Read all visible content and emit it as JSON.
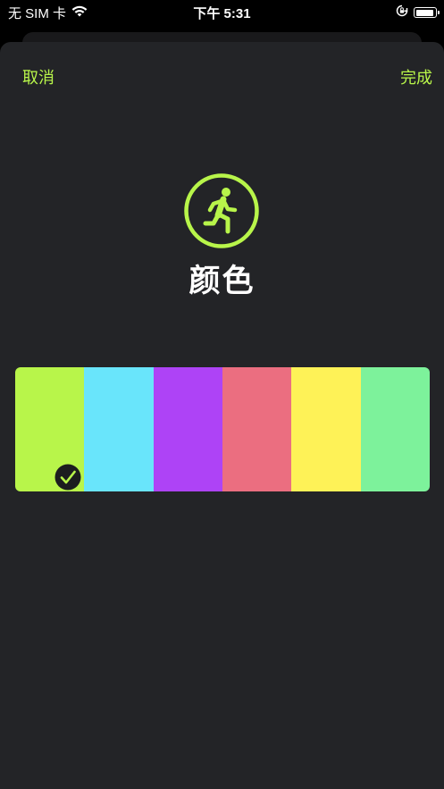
{
  "status_bar": {
    "carrier": "无 SIM 卡",
    "time": "下午 5:31",
    "wifi_icon": "wifi-icon",
    "lock_icon": "orientation-lock-icon",
    "battery_icon": "battery-icon"
  },
  "nav": {
    "cancel_label": "取消",
    "done_label": "完成"
  },
  "header": {
    "icon": "running-figure-icon",
    "title": "颜色"
  },
  "colors": {
    "accent": "#b8f54a",
    "background": "#232427",
    "swatches": [
      {
        "color": "#b8f54a",
        "selected": true
      },
      {
        "color": "#69e5fb",
        "selected": false
      },
      {
        "color": "#ae43f6",
        "selected": false
      },
      {
        "color": "#eb6e80",
        "selected": false
      },
      {
        "color": "#fef257",
        "selected": false
      },
      {
        "color": "#7df29b",
        "selected": false
      }
    ]
  }
}
